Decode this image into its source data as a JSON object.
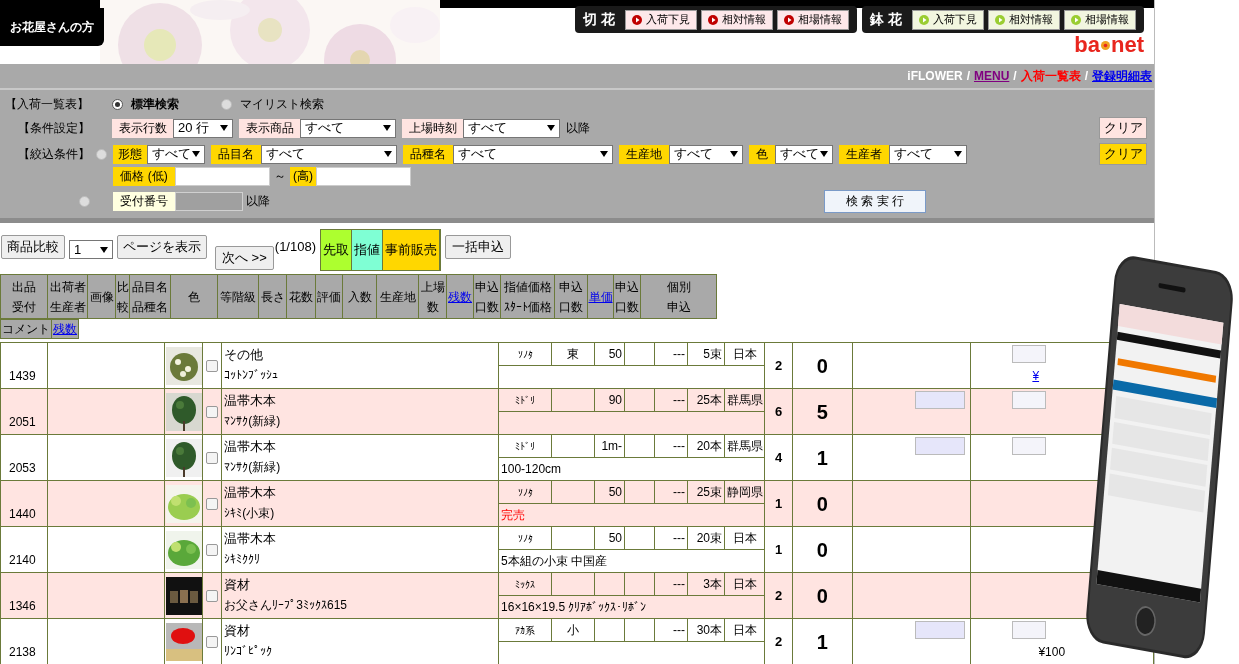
{
  "header": {
    "audience_label": "お花屋さんの方",
    "groups": [
      {
        "kind": "cut",
        "title": "切 花",
        "buttons": [
          "入荷下見",
          "相対情報",
          "相場情報"
        ]
      },
      {
        "kind": "pot",
        "title": "鉢 花",
        "buttons": [
          "入荷下見",
          "相対情報",
          "相場情報"
        ]
      }
    ],
    "logo": {
      "left": "ba",
      "right": "net"
    }
  },
  "breadcrumb": [
    {
      "kind": "plain",
      "text": "iFLOWER"
    },
    {
      "kind": "separator",
      "text": "/"
    },
    {
      "kind": "visited",
      "text": "MENU"
    },
    {
      "kind": "separator",
      "text": "/"
    },
    {
      "kind": "current",
      "text": "入荷一覧表"
    },
    {
      "kind": "separator",
      "text": "/"
    },
    {
      "kind": "link",
      "text": "登録明細表"
    }
  ],
  "search": {
    "title": "【入荷一覧表】",
    "modes": [
      {
        "label": "標準検索",
        "selected": true
      },
      {
        "label": "マイリスト検索",
        "selected": false
      }
    ],
    "conditions": {
      "label": "【条件設定】",
      "fields": [
        {
          "label": "表示行数",
          "value": "20 行"
        },
        {
          "label": "表示商品",
          "value": "すべて"
        },
        {
          "label": "上場時刻",
          "value": "すべて"
        }
      ],
      "suffix": "以降",
      "clear": "クリア"
    },
    "filters": {
      "label": "【絞込条件】",
      "selected": false,
      "fields": [
        {
          "label": "形態",
          "value": "すべて"
        },
        {
          "label": "品目名",
          "value": "すべて"
        },
        {
          "label": "品種名",
          "value": "すべて"
        },
        {
          "label": "生産地",
          "value": "すべて"
        },
        {
          "label": "色",
          "value": "すべて"
        },
        {
          "label": "生産者",
          "value": "すべて"
        }
      ],
      "clear": "クリア",
      "price_low": "価格 (低)",
      "range_sep": "～",
      "price_high": "(高)"
    },
    "receipt": {
      "selected": false,
      "label": "受付番号",
      "suffix": "以降"
    },
    "submit": "検 索 実 行"
  },
  "toolbar": {
    "compare": "商品比較",
    "page": "1",
    "show_page": "ページを表示",
    "next": "次へ >>",
    "page_info": "(1/108)",
    "legend": [
      {
        "text": "先取",
        "color": "#adff2f"
      },
      {
        "text": "指値",
        "color": "#7fffd4"
      },
      {
        "text": "事前販売",
        "color": "#ffd700"
      }
    ],
    "bulk": "一括申込"
  },
  "table": {
    "columns": [
      {
        "lines": [
          "出品",
          "受付"
        ]
      },
      {
        "lines": [
          "出荷者",
          "生産者"
        ]
      },
      {
        "lines": [
          "画像"
        ]
      },
      {
        "lines": [
          "比",
          "較"
        ]
      },
      {
        "lines": [
          "品目名",
          "品種名"
        ]
      },
      {
        "lines": [
          "色"
        ]
      },
      {
        "lines": [
          "等階級"
        ]
      },
      {
        "lines": [
          "長さ"
        ]
      },
      {
        "lines": [
          "花数"
        ]
      },
      {
        "lines": [
          "評価"
        ]
      },
      {
        "lines": [
          "入数"
        ]
      },
      {
        "lines": [
          "生産地"
        ]
      },
      {
        "lines": [
          "上場",
          "数"
        ]
      },
      {
        "lines": [
          "残数"
        ],
        "kind": "link"
      },
      {
        "lines": [
          "申込",
          "口数"
        ]
      },
      {
        "lines": [
          "指値価格",
          "ｽﾀｰﾄ価格"
        ]
      },
      {
        "lines": [
          "申込",
          "口数"
        ]
      },
      {
        "lines": [
          "単価"
        ],
        "kind": "link"
      },
      {
        "lines": [
          "申込",
          "口数"
        ]
      },
      {
        "lines": [
          "個別",
          "申込"
        ]
      }
    ],
    "subheader": [
      {
        "text": "コメント"
      },
      {
        "text": "残数",
        "kind": "link"
      }
    ],
    "rows": [
      {
        "id": "1439",
        "checked": false,
        "name": "その他",
        "variety": "ｺｯﾄﾝﾌﾞｯｼｭ",
        "color_name": "ｿﾉﾀ",
        "grade": "東",
        "length": "50",
        "rating": "---",
        "pack": "5束",
        "origin": "日本",
        "listed": "2",
        "remaining": "0",
        "bid_field": false,
        "order_field": true,
        "price": "¥"
      },
      {
        "id": "2051",
        "checked": false,
        "name": "温帯木本",
        "variety": "ﾏﾝｻｸ(新緑)",
        "color_name": "ﾐﾄﾞﾘ",
        "length": "90",
        "rating": "---",
        "pack": "25本",
        "origin": "群馬県",
        "listed": "6",
        "remaining": "5",
        "bid_field": true,
        "order_field": true
      },
      {
        "id": "2053",
        "checked": false,
        "name": "温帯木本",
        "variety": "ﾏﾝｻｸ(新緑)",
        "color_name": "ﾐﾄﾞﾘ",
        "length": "1m-",
        "rating": "---",
        "pack": "20本",
        "origin": "群馬県",
        "comment": "100-120cm",
        "sold_out": false,
        "listed": "4",
        "remaining": "1",
        "bid_field": true,
        "order_field": true
      },
      {
        "id": "1440",
        "checked": false,
        "name": "温帯木本",
        "variety": "ｼｷﾐ(小束)",
        "color_name": "ｿﾉﾀ",
        "length": "50",
        "rating": "---",
        "pack": "25束",
        "origin": "静岡県",
        "comment": "完売",
        "sold_out": true,
        "listed": "1",
        "remaining": "0",
        "bid_field": false,
        "order_field": false
      },
      {
        "id": "2140",
        "checked": false,
        "name": "温帯木本",
        "variety": "ｼｷﾐｸｸﾘ",
        "color_name": "ｿﾉﾀ",
        "length": "50",
        "rating": "---",
        "pack": "20束",
        "origin": "日本",
        "comment": "5本組の小束 中国産",
        "sold_out": false,
        "listed": "1",
        "remaining": "0",
        "bid_field": false,
        "order_field": false
      },
      {
        "id": "1346",
        "checked": false,
        "name": "資材",
        "variety": "お父さんﾘｰﾌﾟ3ﾐｯｸｽ615",
        "color_name": "ﾐｯｸｽ",
        "rating": "---",
        "pack": "3本",
        "origin": "日本",
        "comment": "16×16×19.5 ｸﾘｱﾎﾞｯｸｽ･ﾘﾎﾞﾝ",
        "sold_out": false,
        "listed": "2",
        "remaining": "0",
        "bid_field": false,
        "order_field": false
      },
      {
        "id": "2138",
        "checked": false,
        "name": "資材",
        "variety": "ﾘﾝｺﾞﾋﾟｯｸ",
        "color_name": "ｱｶ系",
        "grade": "小",
        "rating": "---",
        "pack": "30本",
        "origin": "日本",
        "listed": "2",
        "remaining": "1",
        "bid_field": true,
        "order_field": true,
        "price": "¥100"
      }
    ]
  }
}
